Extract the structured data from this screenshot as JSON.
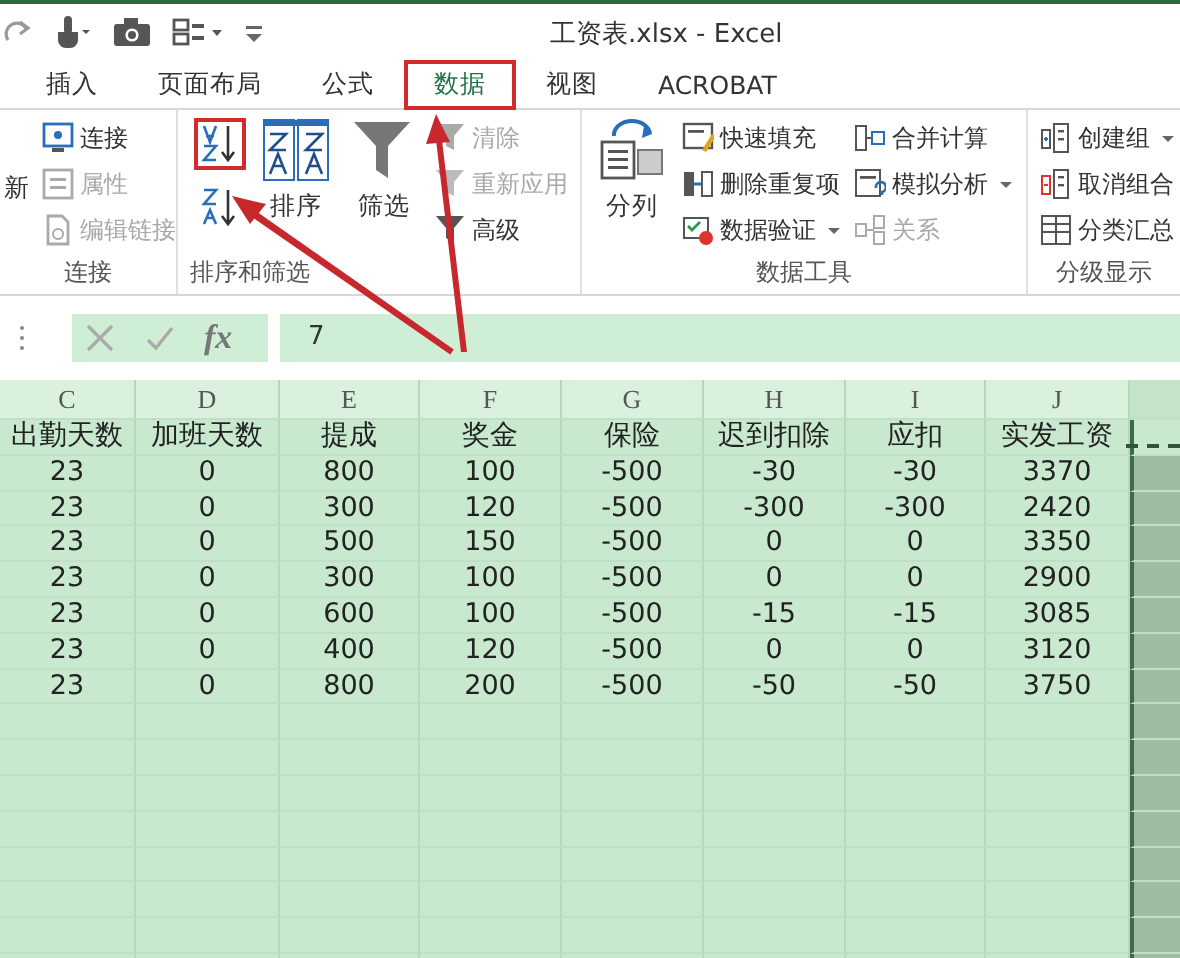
{
  "window": {
    "title": "工资表.xlsx - Excel"
  },
  "tabs": [
    {
      "label": "插入",
      "selected": false,
      "highlighted": false
    },
    {
      "label": "页面布局",
      "selected": false,
      "highlighted": false
    },
    {
      "label": "公式",
      "selected": false,
      "highlighted": false
    },
    {
      "label": "数据",
      "selected": true,
      "highlighted": true
    },
    {
      "label": "视图",
      "selected": false,
      "highlighted": false
    },
    {
      "label": "ACROBAT",
      "selected": false,
      "highlighted": false
    }
  ],
  "ribbon": {
    "groups": [
      {
        "label": "连接",
        "columns": [
          [
            {
              "kind": "large",
              "label": "新",
              "disabled": false
            }
          ],
          [
            {
              "kind": "small",
              "label": "连接",
              "disabled": false
            },
            {
              "kind": "small",
              "label": "属性",
              "disabled": true
            },
            {
              "kind": "small",
              "label": "编辑链接",
              "disabled": true
            }
          ]
        ]
      },
      {
        "label": "排序和筛选",
        "columns": [
          [
            {
              "kind": "icon",
              "highlighted": true,
              "disabled": false
            },
            {
              "kind": "icon",
              "highlighted": false,
              "disabled": false
            }
          ],
          [
            {
              "kind": "large",
              "label": "排序",
              "disabled": false
            }
          ],
          [
            {
              "kind": "large",
              "label": "筛选",
              "disabled": false
            }
          ],
          [
            {
              "kind": "small",
              "label": "清除",
              "disabled": true
            },
            {
              "kind": "small",
              "label": "重新应用",
              "disabled": true
            },
            {
              "kind": "small",
              "label": "高级",
              "disabled": false
            }
          ]
        ]
      },
      {
        "label": "数据工具",
        "columns": [
          [
            {
              "kind": "large",
              "label": "分列",
              "disabled": false
            }
          ],
          [
            {
              "kind": "small",
              "label": "快速填充",
              "disabled": false
            },
            {
              "kind": "small",
              "label": "删除重复项",
              "disabled": false
            },
            {
              "kind": "small",
              "label": "数据验证",
              "disabled": false,
              "dropdown": true
            }
          ],
          [
            {
              "kind": "small",
              "label": "合并计算",
              "disabled": false
            },
            {
              "kind": "small",
              "label": "模拟分析",
              "disabled": false,
              "dropdown": true
            },
            {
              "kind": "small",
              "label": "关系",
              "disabled": true
            }
          ]
        ]
      },
      {
        "label": "分级显示",
        "columns": [
          [
            {
              "kind": "small",
              "label": "创建组",
              "disabled": false,
              "dropdown": true
            },
            {
              "kind": "small",
              "label": "取消组合",
              "disabled": false
            },
            {
              "kind": "small",
              "label": "分类汇总",
              "disabled": false
            }
          ]
        ]
      }
    ]
  },
  "formula_bar": {
    "fx": "fx",
    "value": "7"
  },
  "sheet": {
    "columns": [
      "C",
      "D",
      "E",
      "F",
      "G",
      "H",
      "I",
      "J"
    ],
    "header": [
      "出勤天数",
      "加班天数",
      "提成",
      "奖金",
      "保险",
      "迟到扣除",
      "应扣",
      "实发工资"
    ],
    "rows": [
      [
        "23",
        "0",
        "800",
        "100",
        "-500",
        "-30",
        "-30",
        "3370"
      ],
      [
        "23",
        "0",
        "300",
        "120",
        "-500",
        "-300",
        "-300",
        "2420"
      ],
      [
        "23",
        "0",
        "500",
        "150",
        "-500",
        "0",
        "0",
        "3350"
      ],
      [
        "23",
        "0",
        "300",
        "100",
        "-500",
        "0",
        "0",
        "2900"
      ],
      [
        "23",
        "0",
        "600",
        "100",
        "-500",
        "-15",
        "-15",
        "3085"
      ],
      [
        "23",
        "0",
        "400",
        "120",
        "-500",
        "0",
        "0",
        "3120"
      ],
      [
        "23",
        "0",
        "800",
        "200",
        "-500",
        "-50",
        "-50",
        "3750"
      ]
    ],
    "marquee": true
  },
  "annotations": {
    "arrows": true
  }
}
